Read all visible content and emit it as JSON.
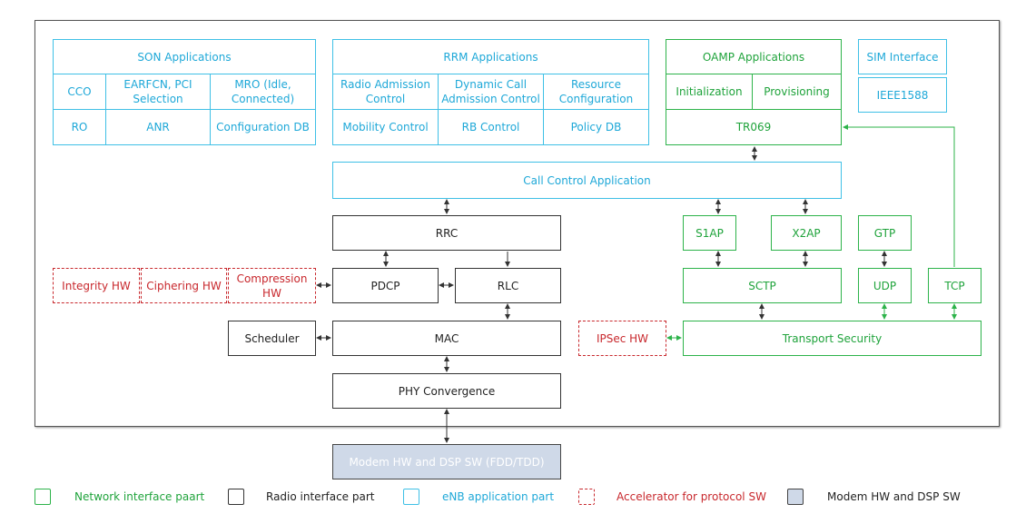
{
  "colors": {
    "application": "#3fc0e6",
    "network": "#2db34a",
    "radio": "#333333",
    "accelerator": "#c8282d",
    "modem": "#cfd9e8"
  },
  "son": {
    "title": "SON Applications",
    "cells": [
      "CCO",
      "EARFCN, PCI Selection",
      "MRO (Idle, Connected)",
      "RO",
      "ANR",
      "Configuration DB"
    ]
  },
  "rrm": {
    "title": "RRM Applications",
    "cells": [
      "Radio Admission Control",
      "Dynamic Call Admission Control",
      "Resource Configuration",
      "Mobility Control",
      "RB Control",
      "Policy DB"
    ]
  },
  "oamp": {
    "title": "OAMP Applications",
    "cells": [
      "Initialization",
      "Provisioning"
    ],
    "tr069": "TR069"
  },
  "sim": "SIM Interface",
  "ieee": "IEEE1588",
  "call_control": "Call Control Application",
  "radio": {
    "rrc": "RRC",
    "pdcp": "PDCP",
    "rlc": "RLC",
    "mac": "MAC",
    "scheduler": "Scheduler",
    "phy": "PHY Convergence"
  },
  "accel": {
    "integrity": "Integrity HW",
    "ciphering": "Ciphering HW",
    "compression": "Compression HW",
    "ipsec": "IPSec HW"
  },
  "network": {
    "s1ap": "S1AP",
    "x2ap": "X2AP",
    "gtp": "GTP",
    "sctp": "SCTP",
    "udp": "UDP",
    "tcp": "TCP",
    "transport": "Transport Security"
  },
  "modem": "Modem HW and DSP SW (FDD/TDD)",
  "legend": [
    "Network interface paart",
    "Radio interface part",
    "eNB application part",
    "Accelerator for protocol SW",
    "Modem HW and DSP SW"
  ]
}
